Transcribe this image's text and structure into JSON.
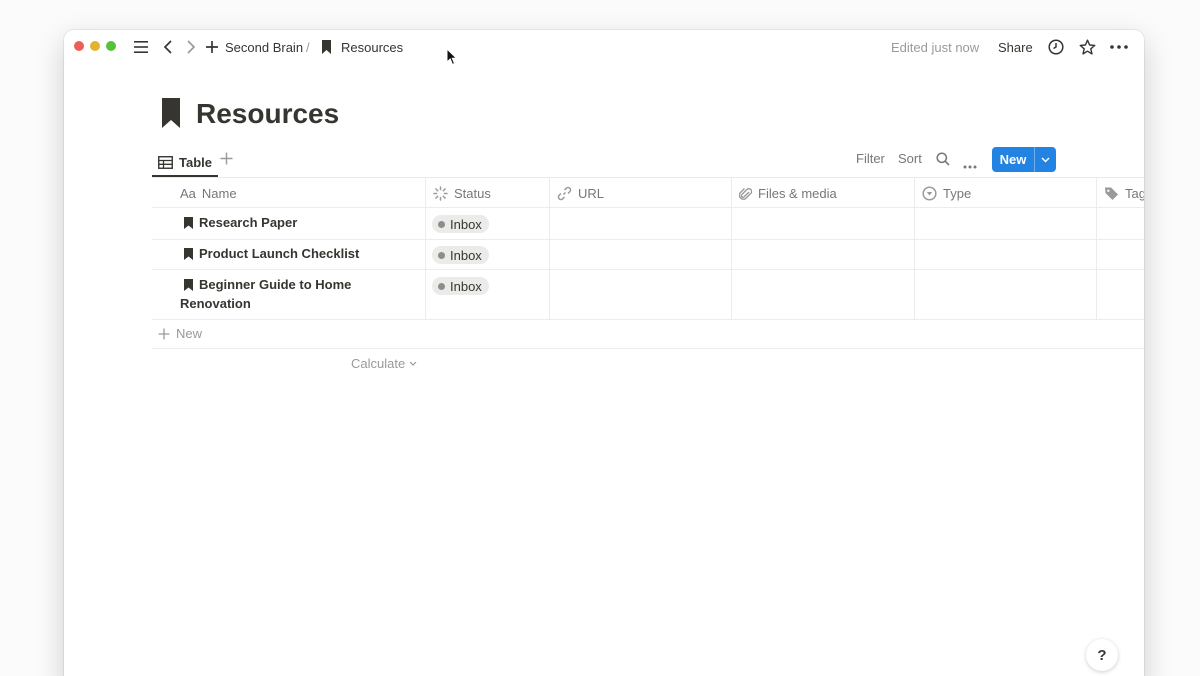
{
  "topbar": {
    "breadcrumb_parent": "Second Brain",
    "breadcrumb_separator": "/",
    "breadcrumb_current": "Resources",
    "edited_status": "Edited just now",
    "share_label": "Share"
  },
  "page": {
    "title": "Resources"
  },
  "views": {
    "active_tab": "Table",
    "filter_label": "Filter",
    "sort_label": "Sort",
    "new_button_label": "New"
  },
  "table": {
    "columns": [
      {
        "label": "Name",
        "prefix": "Aa"
      },
      {
        "label": "Status"
      },
      {
        "label": "URL"
      },
      {
        "label": "Files & media"
      },
      {
        "label": "Type"
      },
      {
        "label": "Tag"
      }
    ],
    "rows": [
      {
        "name": "Research Paper",
        "status": "Inbox"
      },
      {
        "name": "Product Launch Checklist",
        "status": "Inbox"
      },
      {
        "name": "Beginner Guide to Home Renovation",
        "status": "Inbox"
      }
    ],
    "new_row_label": "New",
    "calculate_label": "Calculate"
  },
  "help": {
    "label": "?"
  },
  "colors": {
    "accent": "#2383e2",
    "text": "#37352f",
    "muted": "#9b9a97",
    "tag_bg": "#ebebea"
  }
}
